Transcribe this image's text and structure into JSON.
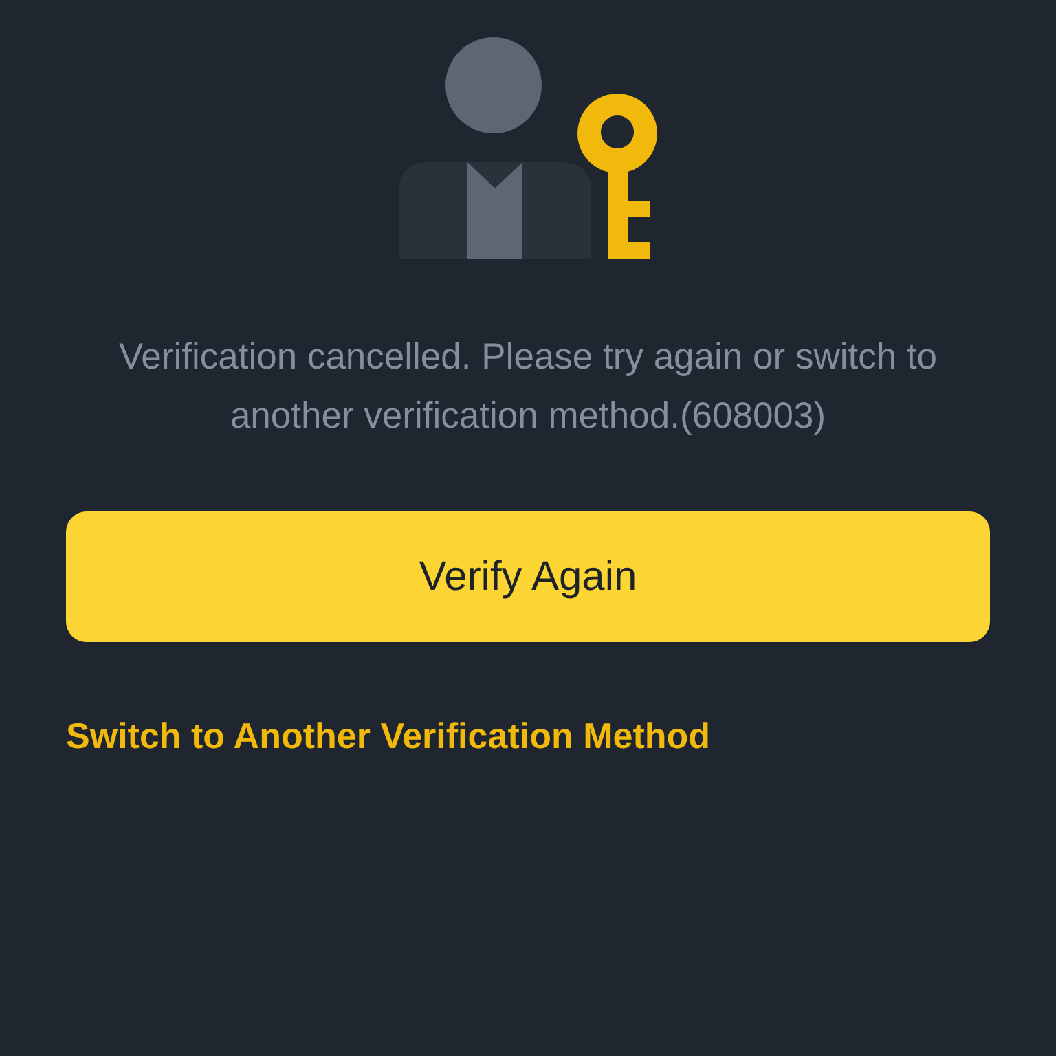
{
  "message": "Verification cancelled. Please try again or switch to another verification method.(608003)",
  "primary_button": {
    "label": "Verify Again"
  },
  "link": {
    "label": "Switch to Another Verification Method"
  }
}
